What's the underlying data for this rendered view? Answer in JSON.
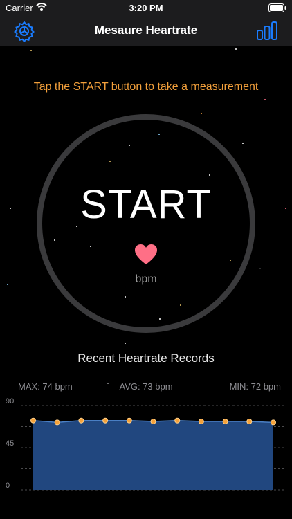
{
  "status_bar": {
    "carrier": "Carrier",
    "time": "3:20 PM"
  },
  "nav": {
    "title": "Mesaure Heartrate"
  },
  "main": {
    "instruction": "Tap the START button to take a measurement",
    "start_label": "START",
    "unit_label": "bpm"
  },
  "records": {
    "title": "Recent Heartrate Records",
    "max_label": "MAX: 74 bpm",
    "avg_label": "AVG: 73 bpm",
    "min_label": "MIN: 72 bpm"
  },
  "colors": {
    "accent_blue": "#1a7cff",
    "instruction_orange": "#f3a03b",
    "heart_pink": "#ff6f86",
    "chart_fill": "#21477f",
    "point_orange": "#f6a23a"
  },
  "icons": {
    "settings": "gear-icon",
    "records": "bar-chart-icon",
    "heart": "heart-icon"
  },
  "chart_data": {
    "type": "area",
    "x": [
      1,
      2,
      3,
      4,
      5,
      6,
      7,
      8,
      9,
      10,
      11
    ],
    "values": [
      74,
      72,
      74,
      74,
      74,
      73,
      74,
      73,
      73,
      73,
      72
    ],
    "y_ticks": [
      "0",
      "45",
      "90"
    ],
    "ylim": [
      0,
      90
    ],
    "grid": true
  }
}
